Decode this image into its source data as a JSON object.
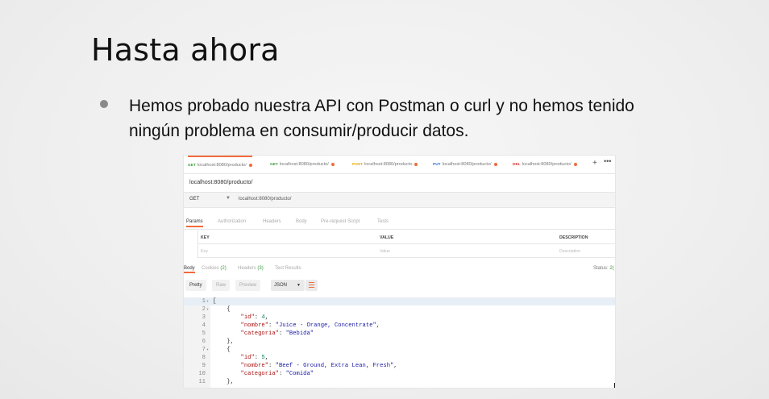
{
  "slide": {
    "title": "Hasta ahora",
    "bullet": "Hemos probado nuestra API con Postman o curl y no hemos tenido ningún problema en consumir/producir datos."
  },
  "postman": {
    "tabs": [
      {
        "method": "GET",
        "url": "localhost:8080/producto/",
        "method_color": "#3a9b3a",
        "active": true
      },
      {
        "method": "GET",
        "url": "localhost:8080/producto/",
        "method_color": "#3a9b3a"
      },
      {
        "method": "POST",
        "url": "localhost:8080/producto",
        "method_color": "#e6a700"
      },
      {
        "method": "PUT",
        "url": "localhost:8080/producto/",
        "method_color": "#2c6fd6"
      },
      {
        "method": "DEL",
        "url": "localhost:8080/producto/",
        "method_color": "#d63333"
      }
    ],
    "tab_actions": {
      "plus": "+",
      "more": "•••"
    },
    "request_title": "localhost:8080/producto/",
    "method": "GET",
    "url": "localhost:8080/producto/",
    "request_tabs": [
      "Params",
      "Authorization",
      "Headers",
      "Body",
      "Pre-request Script",
      "Tests"
    ],
    "params_table": {
      "headers": [
        "KEY",
        "VALUE",
        "DESCRIPTION"
      ],
      "placeholders": [
        "Key",
        "Value",
        "Description"
      ]
    },
    "response_tabs": {
      "body": "Body",
      "cookies": "Cookies",
      "cookies_count": "(2)",
      "headers": "Headers",
      "headers_count": "(3)",
      "tests": "Test Results"
    },
    "status_label": "Status:",
    "status_value": "2(",
    "format_buttons": [
      "Pretty",
      "Raw",
      "Preview"
    ],
    "format_select": "JSON",
    "code_lines": [
      {
        "num": "1",
        "fold": "▾",
        "text": "[",
        "hl": true
      },
      {
        "num": "2",
        "fold": "▾",
        "text": "    {"
      },
      {
        "num": "3",
        "text": "        ",
        "key": "\"id\"",
        "sep": ": ",
        "num_val": "4",
        "tail": ","
      },
      {
        "num": "4",
        "text": "        ",
        "key": "\"nombre\"",
        "sep": ": ",
        "str_val": "\"Juice - Orange, Concentrate\"",
        "tail": ","
      },
      {
        "num": "5",
        "text": "        ",
        "key": "\"categoria\"",
        "sep": ": ",
        "str_val": "\"Bebida\""
      },
      {
        "num": "6",
        "text": "    },"
      },
      {
        "num": "7",
        "fold": "▾",
        "text": "    {"
      },
      {
        "num": "8",
        "text": "        ",
        "key": "\"id\"",
        "sep": ": ",
        "num_val": "5",
        "tail": ","
      },
      {
        "num": "9",
        "text": "        ",
        "key": "\"nombre\"",
        "sep": ": ",
        "str_val": "\"Beef - Ground, Extra Lean, Fresh\"",
        "tail": ","
      },
      {
        "num": "10",
        "text": "        ",
        "key": "\"categoria\"",
        "sep": ": ",
        "str_val": "\"Comida\""
      },
      {
        "num": "11",
        "text": "    },"
      }
    ]
  }
}
